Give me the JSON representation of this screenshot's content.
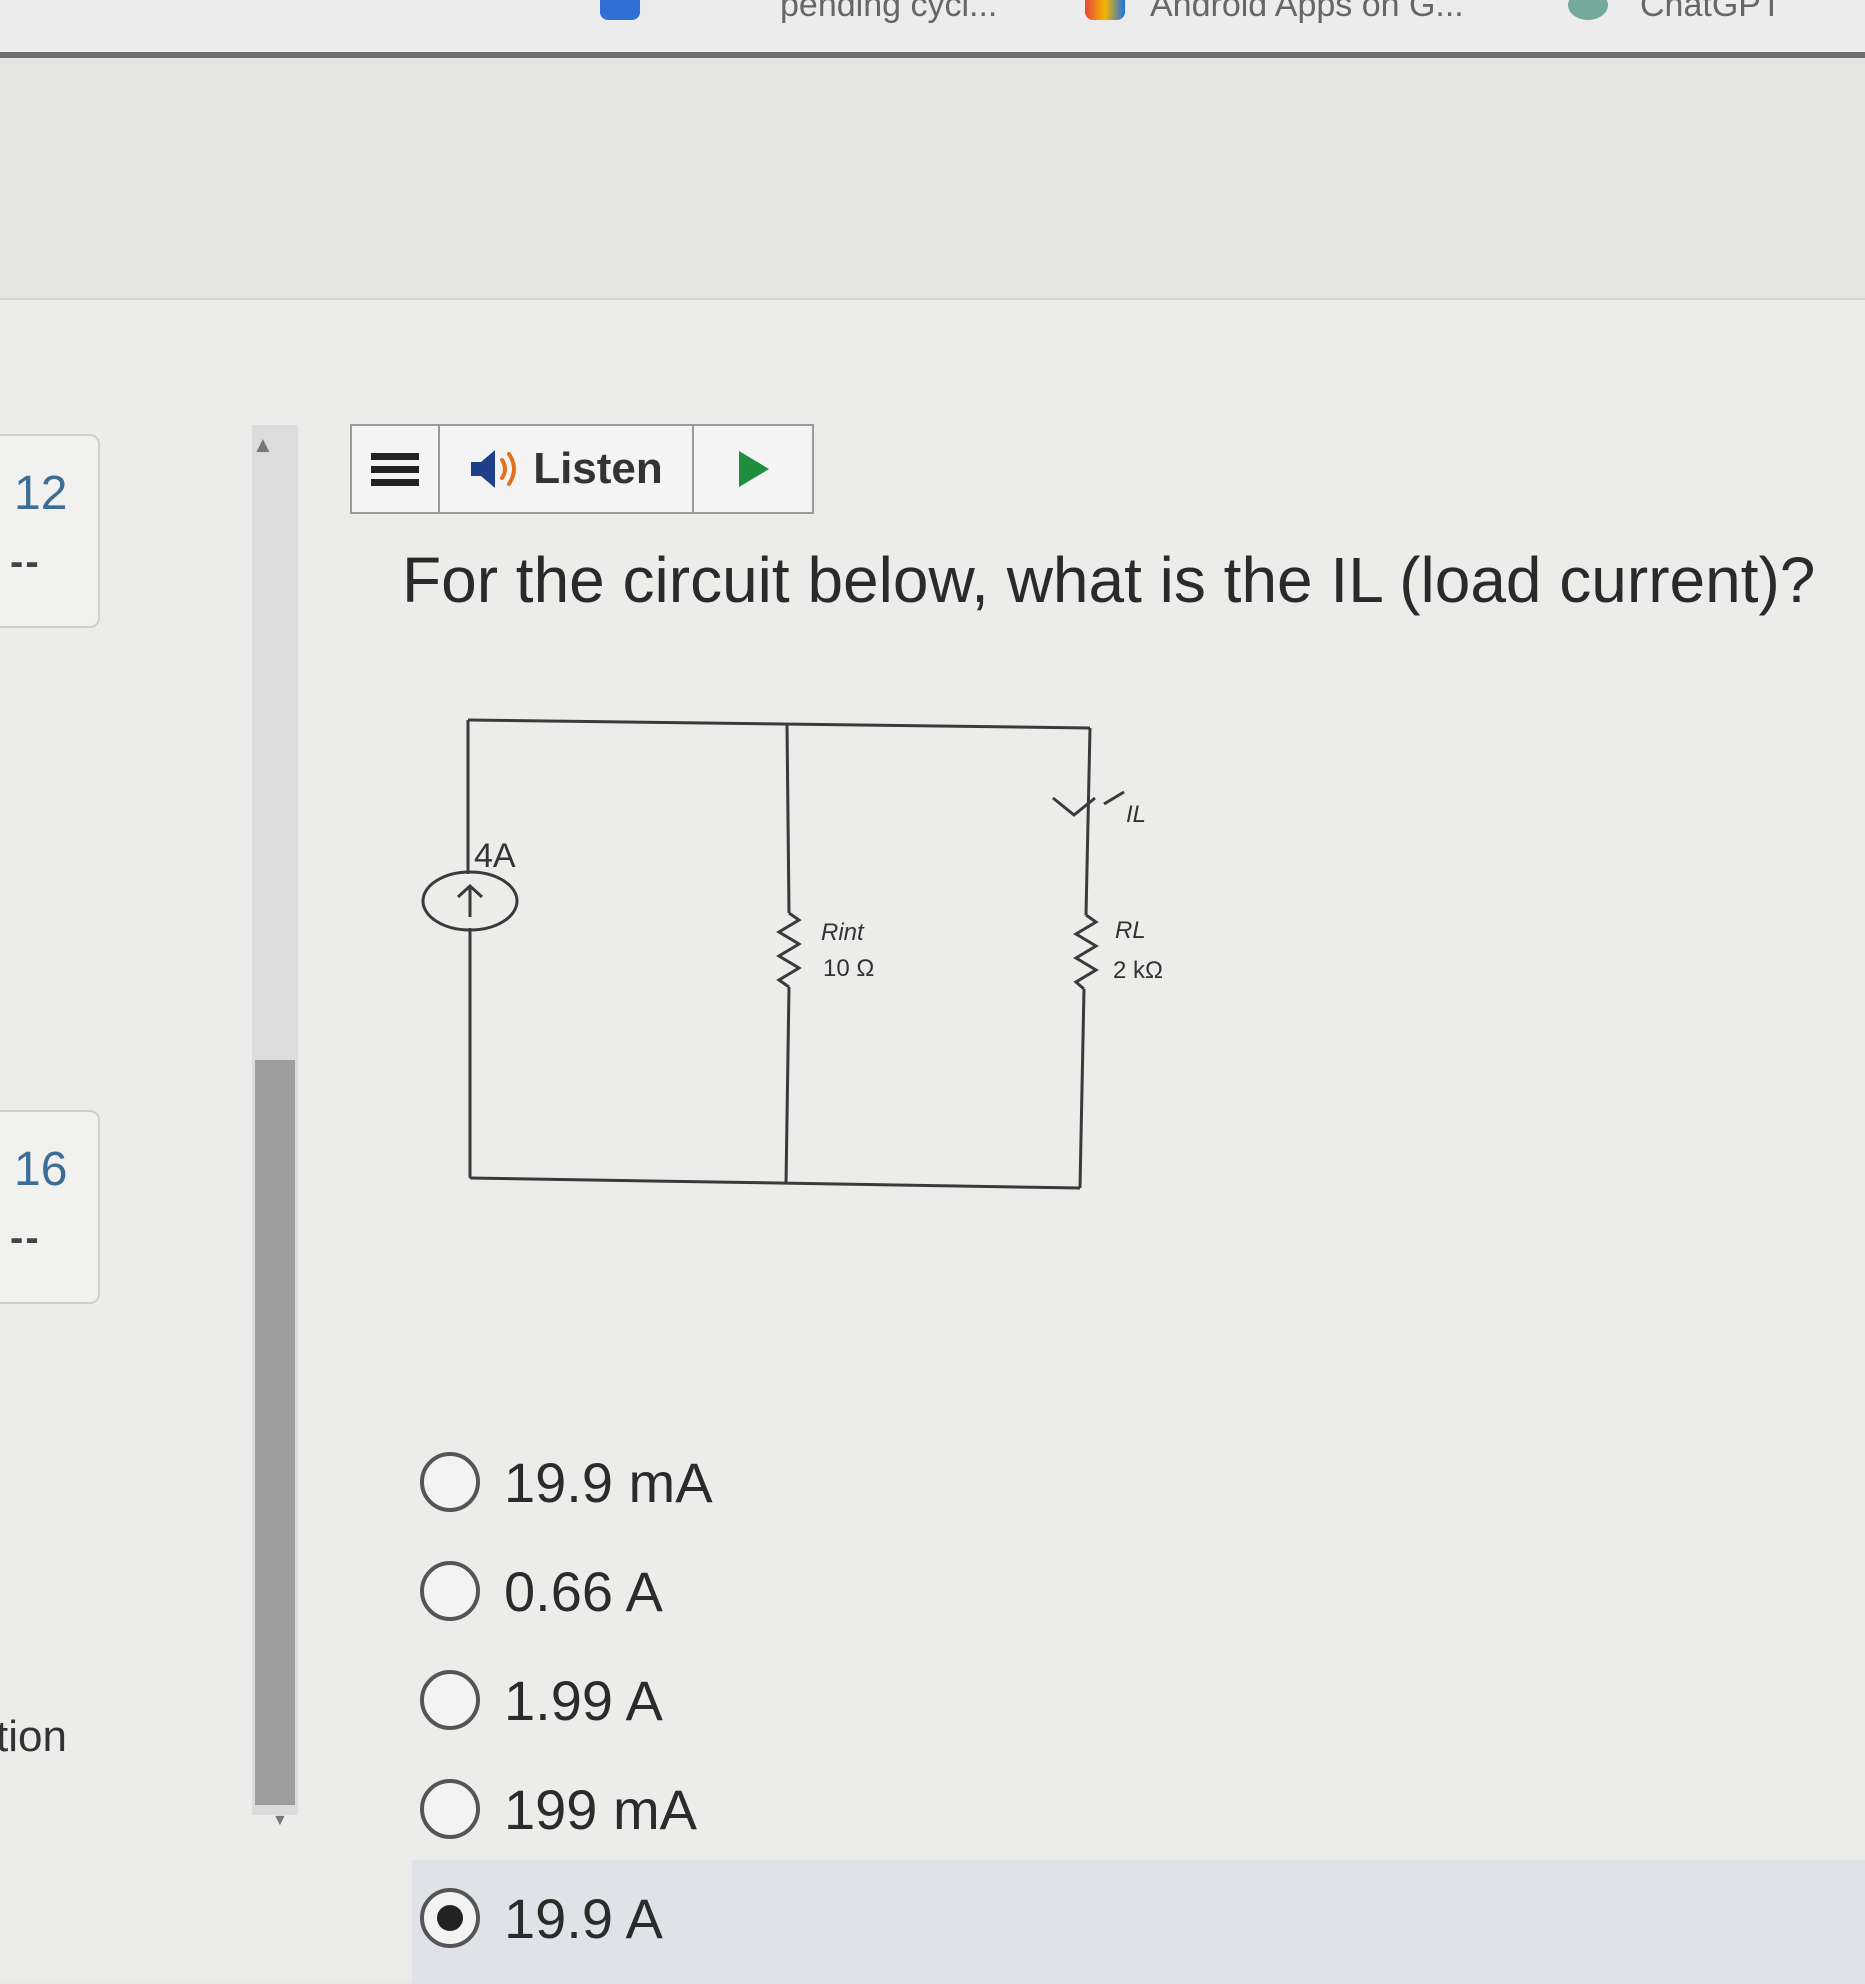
{
  "browser": {
    "bookmarks": [
      {
        "label": "pending cycl...",
        "icon": "bookmark-blue-icon"
      },
      {
        "label": "Android Apps on G...",
        "icon": "google-play-icon"
      },
      {
        "label": "ChatGPT",
        "icon": "chatgpt-icon"
      }
    ]
  },
  "sidebar": {
    "questions": [
      {
        "number": "12",
        "status": "--"
      },
      {
        "number": "16",
        "status": "--"
      }
    ],
    "partial_text": "tion"
  },
  "toolbar": {
    "menu_icon": "menu-icon",
    "listen_icon": "speaker-icon",
    "listen_label": "Listen",
    "play_icon": "play-icon",
    "play_color": "#1e8e3e"
  },
  "question": {
    "text": "For the circuit below, what is the IL (load current)?"
  },
  "circuit": {
    "source_label": "4A",
    "r_int_symbol": "Rint",
    "r_int_value": "10 Ω",
    "r_load_symbol": "RL",
    "r_load_value": "2 kΩ",
    "current_label": "IL"
  },
  "answers": {
    "options": [
      {
        "label": "19.9 mA",
        "selected": false
      },
      {
        "label": "0.66 A",
        "selected": false
      },
      {
        "label": "1.99 A",
        "selected": false
      },
      {
        "label": "199 mA",
        "selected": false
      },
      {
        "label": "19.9 A",
        "selected": true
      }
    ]
  }
}
